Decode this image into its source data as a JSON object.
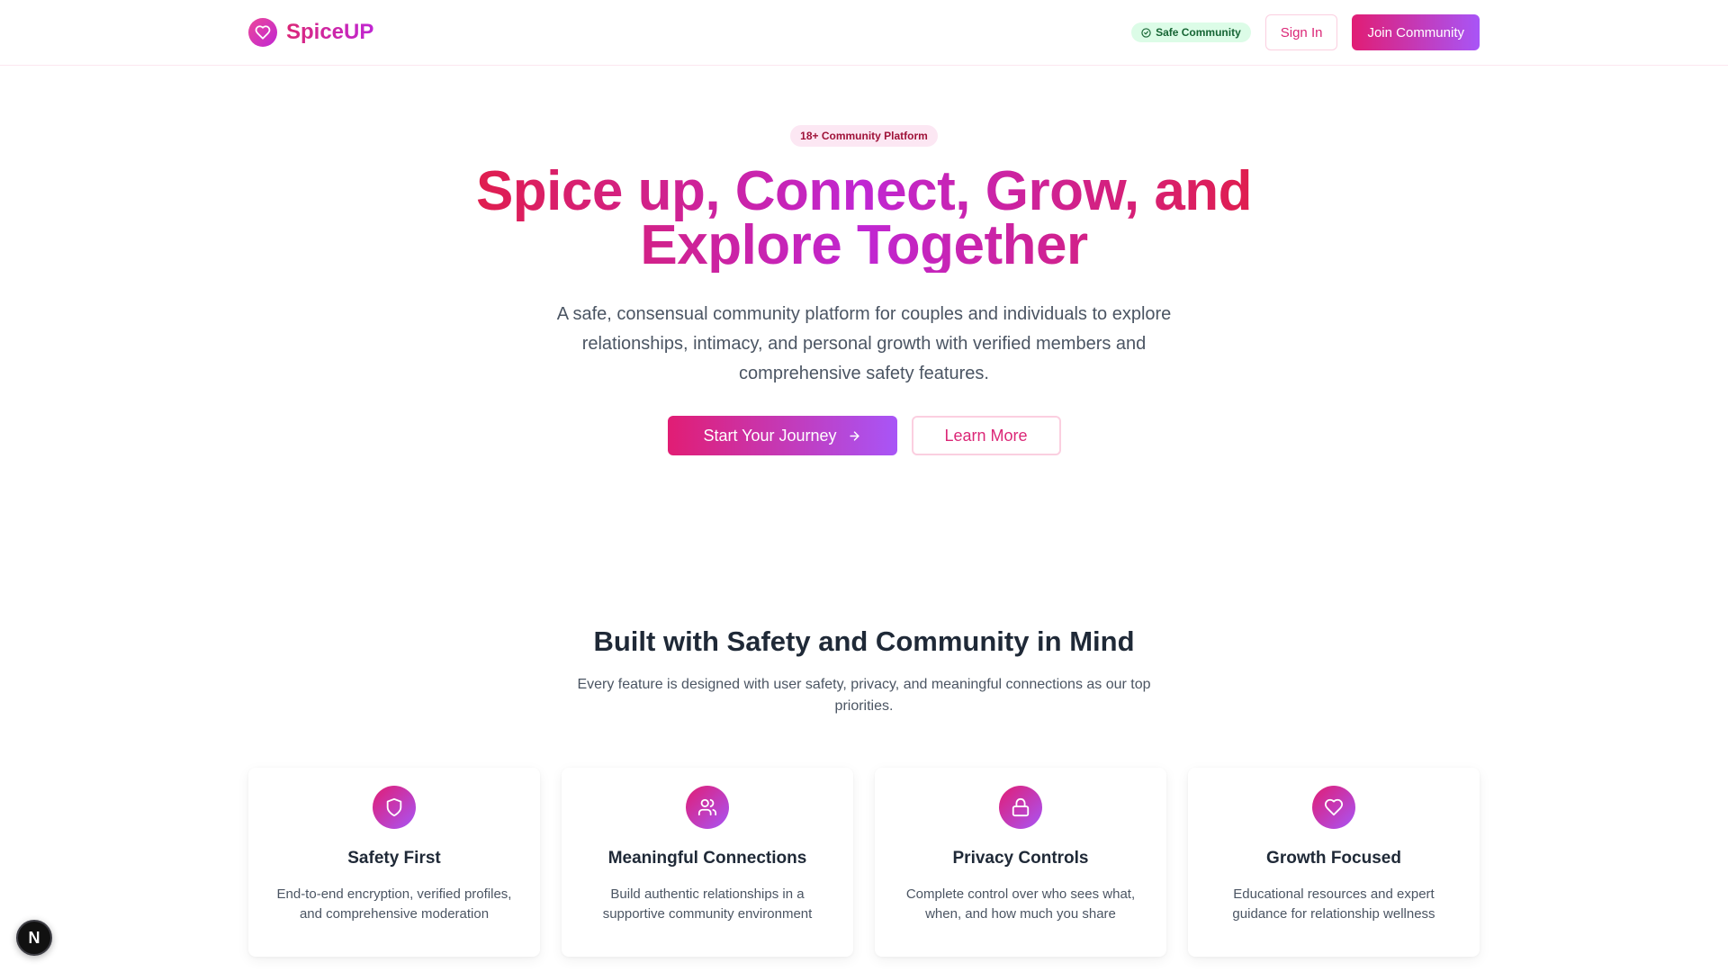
{
  "header": {
    "brand": "SpiceUP",
    "safe_badge": "Safe Community",
    "sign_in": "Sign In",
    "join": "Join Community"
  },
  "hero": {
    "pill": "18+ Community Platform",
    "title_line1": "Spice up, Connect, Grow, and",
    "title_line2": "Explore Together",
    "subtitle": "A safe, consensual community platform for couples and individuals to explore relationships, intimacy, and personal growth with verified members and comprehensive safety features.",
    "primary_cta": "Start Your Journey",
    "secondary_cta": "Learn More"
  },
  "features": {
    "title": "Built with Safety and Community in Mind",
    "subtitle": "Every feature is designed with user safety, privacy, and meaningful connections as our top priorities.",
    "cards": [
      {
        "icon": "shield-icon",
        "title": "Safety First",
        "desc": "End-to-end encryption, verified profiles, and comprehensive moderation"
      },
      {
        "icon": "users-icon",
        "title": "Meaningful Connections",
        "desc": "Build authentic relationships in a supportive community environment"
      },
      {
        "icon": "lock-icon",
        "title": "Privacy Controls",
        "desc": "Complete control over who sees what, when, and how much you share"
      },
      {
        "icon": "heart-icon",
        "title": "Growth Focused",
        "desc": "Educational resources and expert guidance for relationship wellness"
      }
    ]
  },
  "fab": {
    "label": "N"
  },
  "colors": {
    "brand_pink": "#db2777",
    "brand_purple": "#a855f7",
    "badge_green_bg": "#dcfce7",
    "badge_green_text": "#166534"
  }
}
